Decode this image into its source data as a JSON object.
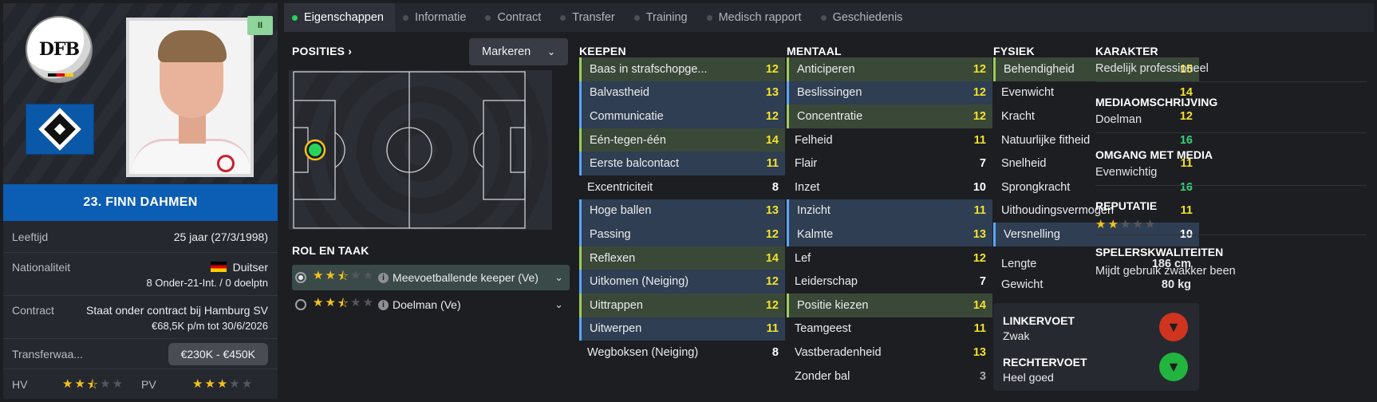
{
  "player": {
    "name": "23. FINN DAHMEN",
    "pause_tag": "II",
    "crest_dfb_text": "DFB",
    "age_label": "Leeftijd",
    "age_value": "25 jaar  (27/3/1998)",
    "nationality_label": "Nationaliteit",
    "nationality_value": "Duitser",
    "nationality_caps": "8 Onder-21-Int. / 0 doelptn",
    "contract_label": "Contract",
    "contract_value": "Staat onder contract bij Hamburg SV",
    "contract_terms": "€68,5K p/m tot 30/6/2026",
    "transfer_label": "Transferwaa...",
    "transfer_value": "€230K - €450K",
    "ca_label": "HV",
    "ca_stars": 2.5,
    "pa_label": "PV",
    "pa_stars": 3
  },
  "tabs": [
    {
      "label": "Eigenschappen",
      "active": true
    },
    {
      "label": "Informatie",
      "active": false
    },
    {
      "label": "Contract",
      "active": false
    },
    {
      "label": "Transfer",
      "active": false
    },
    {
      "label": "Training",
      "active": false
    },
    {
      "label": "Medisch rapport",
      "active": false
    },
    {
      "label": "Geschiedenis",
      "active": false
    }
  ],
  "positions": {
    "title": "POSITIES",
    "title_chevron": "›",
    "mark_button": "Markeren",
    "chevron": "⌄"
  },
  "roles": {
    "title": "ROL EN TAAK",
    "items": [
      {
        "label": "Meevoetballende keeper (Ve)",
        "stars": 2.5,
        "selected": true
      },
      {
        "label": "Doelman (Ve)",
        "stars": 2.5,
        "selected": false
      }
    ],
    "info_glyph": "i",
    "chevron": "⌄"
  },
  "columns": {
    "keepen": {
      "title": "KEEPEN",
      "attrs": [
        {
          "label": "Baas in strafschopge...",
          "value": "12",
          "hl": "green",
          "color": "yellow"
        },
        {
          "label": "Balvastheid",
          "value": "13",
          "hl": "blue",
          "color": "yellow"
        },
        {
          "label": "Communicatie",
          "value": "12",
          "hl": "blue",
          "color": "yellow"
        },
        {
          "label": "Eén-tegen-één",
          "value": "14",
          "hl": "green",
          "color": "yellow"
        },
        {
          "label": "Eerste balcontact",
          "value": "11",
          "hl": "blue",
          "color": "yellow"
        },
        {
          "label": "Excentriciteit",
          "value": "8",
          "hl": "none",
          "color": "white"
        },
        {
          "label": "Hoge ballen",
          "value": "13",
          "hl": "blue",
          "color": "yellow"
        },
        {
          "label": "Passing",
          "value": "12",
          "hl": "blue",
          "color": "yellow"
        },
        {
          "label": "Reflexen",
          "value": "14",
          "hl": "green",
          "color": "yellow"
        },
        {
          "label": "Uitkomen (Neiging)",
          "value": "12",
          "hl": "blue",
          "color": "yellow"
        },
        {
          "label": "Uittrappen",
          "value": "12",
          "hl": "green",
          "color": "yellow"
        },
        {
          "label": "Uitwerpen",
          "value": "11",
          "hl": "blue",
          "color": "yellow"
        },
        {
          "label": "Wegboksen (Neiging)",
          "value": "8",
          "hl": "none",
          "color": "white"
        }
      ]
    },
    "mentaal": {
      "title": "MENTAAL",
      "attrs": [
        {
          "label": "Anticiperen",
          "value": "12",
          "hl": "green",
          "color": "yellow"
        },
        {
          "label": "Beslissingen",
          "value": "12",
          "hl": "blue",
          "color": "yellow"
        },
        {
          "label": "Concentratie",
          "value": "12",
          "hl": "green",
          "color": "yellow"
        },
        {
          "label": "Felheid",
          "value": "11",
          "hl": "none",
          "color": "yellow"
        },
        {
          "label": "Flair",
          "value": "7",
          "hl": "none",
          "color": "white"
        },
        {
          "label": "Inzet",
          "value": "10",
          "hl": "none",
          "color": "white"
        },
        {
          "label": "Inzicht",
          "value": "11",
          "hl": "blue",
          "color": "yellow"
        },
        {
          "label": "Kalmte",
          "value": "13",
          "hl": "blue",
          "color": "yellow"
        },
        {
          "label": "Lef",
          "value": "12",
          "hl": "none",
          "color": "yellow"
        },
        {
          "label": "Leiderschap",
          "value": "7",
          "hl": "none",
          "color": "white"
        },
        {
          "label": "Positie kiezen",
          "value": "14",
          "hl": "green",
          "color": "yellow"
        },
        {
          "label": "Teamgeest",
          "value": "11",
          "hl": "none",
          "color": "yellow"
        },
        {
          "label": "Vastberadenheid",
          "value": "13",
          "hl": "none",
          "color": "yellow"
        },
        {
          "label": "Zonder bal",
          "value": "3",
          "hl": "none",
          "color": "gray"
        }
      ]
    },
    "fysiek": {
      "title": "FYSIEK",
      "attrs": [
        {
          "label": "Behendigheid",
          "value": "15",
          "hl": "green",
          "color": "yellow"
        },
        {
          "label": "Evenwicht",
          "value": "14",
          "hl": "none",
          "color": "yellow"
        },
        {
          "label": "Kracht",
          "value": "12",
          "hl": "none",
          "color": "yellow"
        },
        {
          "label": "Natuurlijke fitheid",
          "value": "16",
          "hl": "none",
          "color": "green"
        },
        {
          "label": "Snelheid",
          "value": "11",
          "hl": "none",
          "color": "yellow"
        },
        {
          "label": "Sprongkracht",
          "value": "16",
          "hl": "none",
          "color": "green"
        },
        {
          "label": "Uithoudingsvermogen",
          "value": "11",
          "hl": "none",
          "color": "yellow"
        },
        {
          "label": "Versnelling",
          "value": "10",
          "hl": "blue",
          "color": "white"
        }
      ],
      "height_label": "Lengte",
      "height_value": "186 cm",
      "weight_label": "Gewicht",
      "weight_value": "80 kg",
      "left_foot_label": "LINKERVOET",
      "left_foot_value": "Zwak",
      "right_foot_label": "RECHTERVOET",
      "right_foot_value": "Heel goed"
    }
  },
  "profile": [
    {
      "label": "KARAKTER",
      "value": "Redelijk professioneel"
    },
    {
      "label": "MEDIAOMSCHRIJVING",
      "value": "Doelman"
    },
    {
      "label": "OMGANG MET MEDIA",
      "value": "Evenwichtig"
    },
    {
      "label": "REPUTATIE",
      "stars": 2
    },
    {
      "label": "SPELERSKWALITEITEN",
      "value": "Mijdt gebruik zwakker been"
    }
  ],
  "colors": {
    "accent_blue": "#0c5db4",
    "attr_yellow": "#f2e22b",
    "attr_green": "#33d17a",
    "tab_active_dot": "#27d45a"
  }
}
